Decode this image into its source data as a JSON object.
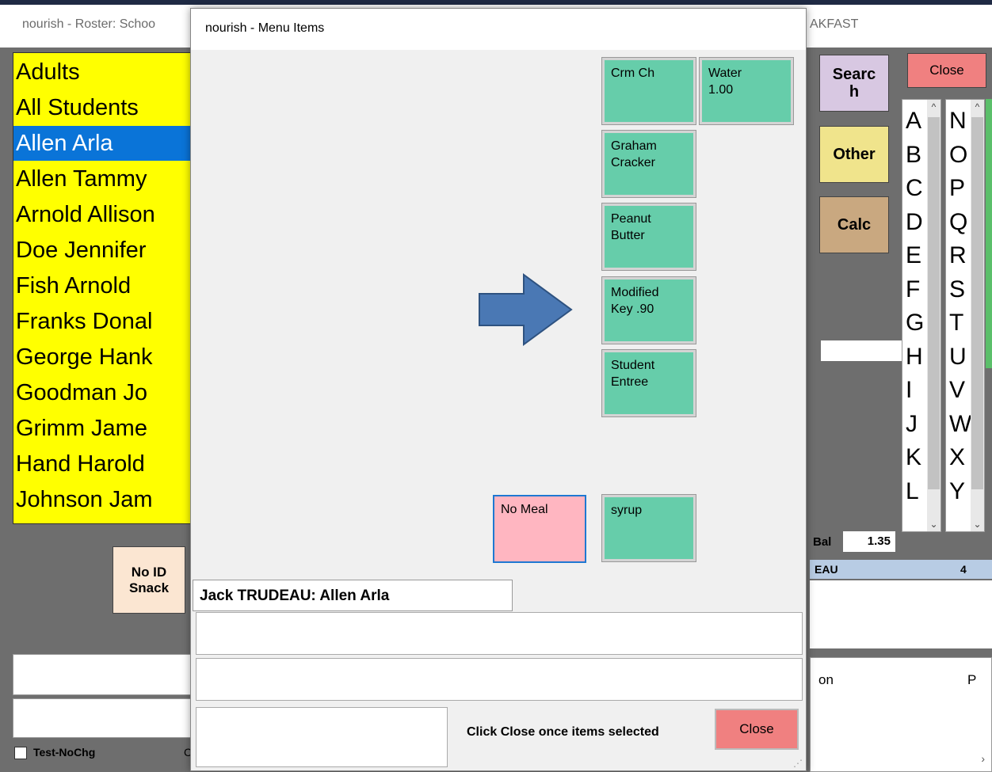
{
  "background_window": {
    "title_left": "nourish - Roster: Schoo",
    "title_right": "AKFAST",
    "roster_items": [
      "Adults",
      "All Students",
      "Allen Arla",
      "Allen Tammy",
      "Arnold Allison",
      "Doe Jennifer",
      "Fish Arnold",
      "Franks Donal",
      "George Hank",
      "Goodman Jo",
      "Grimm Jame",
      "Hand Harold",
      "Johnson Jam"
    ],
    "selected_index": 2,
    "search_label": "Searc\nh",
    "close_label": "Close",
    "other_label": "Other",
    "calc_label": "Calc",
    "alpha_left": [
      "A",
      "B",
      "C",
      "D",
      "E",
      "F",
      "G",
      "H",
      "I",
      "J",
      "K",
      "L"
    ],
    "alpha_right": [
      "N",
      "O",
      "P",
      "Q",
      "R",
      "S",
      "T",
      "U",
      "V",
      "W",
      "X",
      "Y"
    ],
    "bal_label": "Bal",
    "bal_value": "1.35",
    "name_strip": "EAU",
    "name_strip_num": "4",
    "table_header_1": "on",
    "table_header_2": "P",
    "no_id_snack_label": "No ID\nSnack",
    "test_nochg_label": "Test-NoChg",
    "c_letter": "C",
    "scroll_right_arrow": "›"
  },
  "dialog": {
    "title": "nourish - Menu Items",
    "items": [
      {
        "id": "crm",
        "label": "Crm Ch"
      },
      {
        "id": "water",
        "label": "Water\n1.00"
      },
      {
        "id": "graham",
        "label": "Graham\nCracker"
      },
      {
        "id": "peanut",
        "label": "Peanut\nButter"
      },
      {
        "id": "modified",
        "label": "Modified\nKey .90"
      },
      {
        "id": "entree",
        "label": "Student\nEntree"
      },
      {
        "id": "nomeal",
        "label": "No Meal"
      },
      {
        "id": "syrup",
        "label": "syrup"
      }
    ],
    "customer_label": "Jack TRUDEAU: Allen Arla",
    "hint": "Click Close once items selected",
    "close_label": "Close"
  },
  "colors": {
    "menu_item": "#66cdaa",
    "no_meal": "#ffb6c1",
    "roster_bg": "#ffff00",
    "selected": "#0a74d8",
    "close": "#f08080",
    "arrow": "#4a78b4"
  },
  "icons": {
    "callout": "arrow-right-icon",
    "scroll_up": "chevron-up-icon",
    "scroll_down": "chevron-down-icon",
    "resize": "resize-grip-icon"
  }
}
